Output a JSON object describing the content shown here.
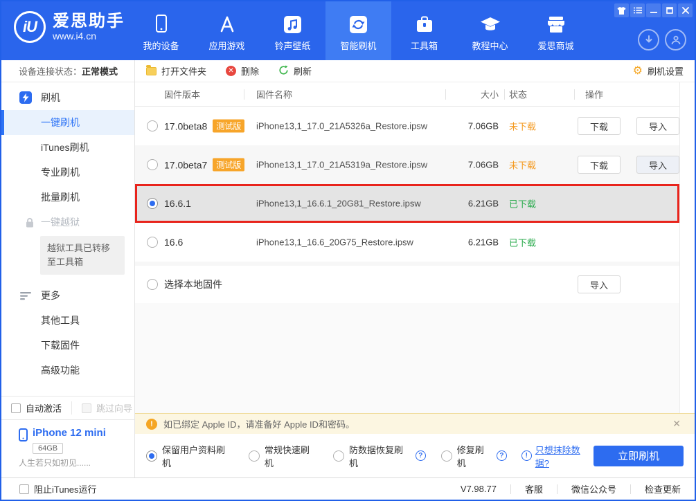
{
  "header": {
    "logo": {
      "mark": "iU",
      "title": "爱思助手",
      "url": "www.i4.cn"
    },
    "nav": [
      {
        "label": "我的设备"
      },
      {
        "label": "应用游戏"
      },
      {
        "label": "铃声壁纸"
      },
      {
        "label": "智能刷机"
      },
      {
        "label": "工具箱"
      },
      {
        "label": "教程中心"
      },
      {
        "label": "爱思商城"
      }
    ]
  },
  "sidebar": {
    "status": {
      "label": "设备连接状态：",
      "value": "正常模式"
    },
    "section_flash": "刷机",
    "items_flash": [
      "一键刷机",
      "iTunes刷机",
      "专业刷机",
      "批量刷机"
    ],
    "jailbreak": "一键越狱",
    "jailbreak_note": "越狱工具已转移至工具箱",
    "section_more": "更多",
    "items_more": [
      "其他工具",
      "下载固件",
      "高级功能"
    ],
    "check_auto": "自动激活",
    "check_skip": "跳过向导",
    "device": {
      "name": "iPhone 12 mini",
      "capacity": "64GB",
      "signature": "人生若只如初见......"
    }
  },
  "toolbar": {
    "open_folder": "打开文件夹",
    "delete": "删除",
    "refresh": "刷新",
    "settings": "刷机设置"
  },
  "table": {
    "headers": [
      "固件版本",
      "固件名称",
      "大小",
      "状态",
      "操作"
    ],
    "action_download": "下载",
    "action_import": "导入",
    "rows": [
      {
        "version": "17.0beta8",
        "badge": "测试版",
        "name": "iPhone13,1_17.0_21A5326a_Restore.ipsw",
        "size": "7.06GB",
        "status": "未下载"
      },
      {
        "version": "17.0beta7",
        "badge": "测试版",
        "name": "iPhone13,1_17.0_21A5319a_Restore.ipsw",
        "size": "7.06GB",
        "status": "未下载"
      },
      {
        "version": "16.6.1",
        "name": "iPhone13,1_16.6.1_20G81_Restore.ipsw",
        "size": "6.21GB",
        "status": "已下载"
      },
      {
        "version": "16.6",
        "name": "iPhone13,1_16.6_20G75_Restore.ipsw",
        "size": "6.21GB",
        "status": "已下载"
      }
    ],
    "local_label": "选择本地固件"
  },
  "notice": {
    "text": "如已绑定 Apple ID，请准备好 Apple ID和密码。"
  },
  "options": {
    "radios": [
      "保留用户资料刷机",
      "常规快速刷机",
      "防数据恢复刷机",
      "修复刷机"
    ],
    "erase_link": "只想抹除数据?",
    "flash_button": "立即刷机"
  },
  "statusbar": {
    "block_itunes": "阻止iTunes运行",
    "version": "V7.98.77",
    "links": [
      "客服",
      "微信公众号",
      "检查更新"
    ]
  },
  "colors": {
    "accent": "#2d6cf0",
    "header": "#2a65ec",
    "orange": "#f5a623",
    "green": "#2bab4e",
    "red": "#e8241c"
  }
}
